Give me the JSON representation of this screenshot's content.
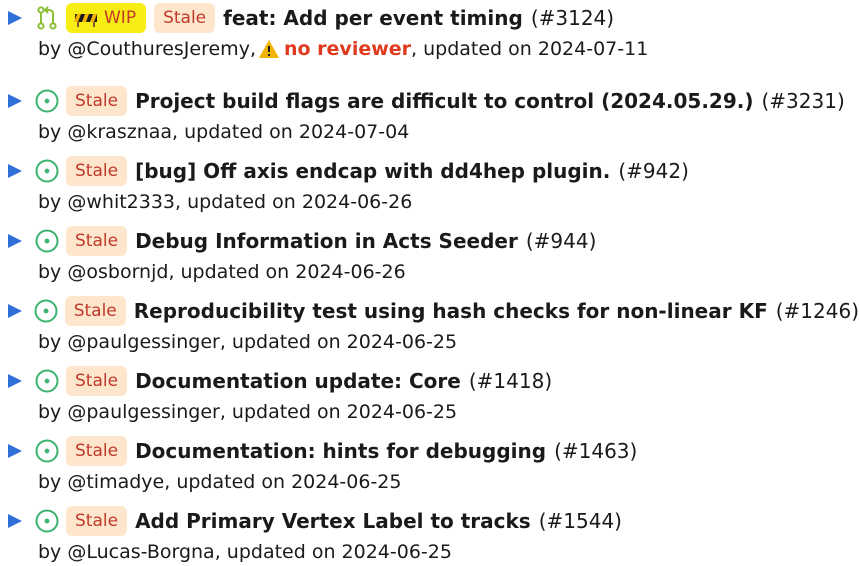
{
  "colors": {
    "accent_arrow": "#2f6fd8",
    "open_icon": "#3cb371",
    "draft_icon": "#8bbf35",
    "stale_bg": "#fde6cc",
    "wip_bg": "#f7ec14",
    "no_reviewer": "#e03a1e",
    "warning": "#f0b400"
  },
  "items": [
    {
      "icon": "pull-request-icon",
      "wip_label": "WIP",
      "stale_label": "Stale",
      "title": "feat: Add per event timing",
      "number": "(#3124)",
      "by": "by ",
      "author": "@CouthuresJeremy",
      "sep": ",",
      "no_reviewer": "no reviewer",
      "updated": ", updated on 2024-07-11"
    },
    {
      "icon": "issue-open-icon",
      "stale_label": "Stale",
      "title": "Project build flags are difficult to control (2024.05.29.)",
      "number": "(#3231)",
      "by": "by ",
      "author": "@krasznaa",
      "updated": ", updated on 2024-07-04"
    },
    {
      "icon": "issue-open-icon",
      "stale_label": "Stale",
      "title": "[bug] Off axis endcap with dd4hep plugin.",
      "number": "(#942)",
      "by": "by ",
      "author": "@whit2333",
      "updated": ", updated on 2024-06-26"
    },
    {
      "icon": "issue-open-icon",
      "stale_label": "Stale",
      "title": "Debug Information in Acts Seeder",
      "number": "(#944)",
      "by": "by ",
      "author": "@osbornjd",
      "updated": ", updated on 2024-06-26"
    },
    {
      "icon": "issue-open-icon",
      "stale_label": "Stale",
      "title": "Reproducibility test using hash checks for non-linear KF",
      "number": "(#1246)",
      "by": "by ",
      "author": "@paulgessinger",
      "updated": ", updated on 2024-06-25"
    },
    {
      "icon": "issue-open-icon",
      "stale_label": "Stale",
      "title": "Documentation update: Core",
      "number": "(#1418)",
      "by": "by ",
      "author": "@paulgessinger",
      "updated": ", updated on 2024-06-25"
    },
    {
      "icon": "issue-open-icon",
      "stale_label": "Stale",
      "title": "Documentation: hints for debugging",
      "number": "(#1463)",
      "by": "by ",
      "author": "@timadye",
      "updated": ", updated on 2024-06-25"
    },
    {
      "icon": "issue-open-icon",
      "stale_label": "Stale",
      "title": "Add Primary Vertex Label to tracks",
      "number": "(#1544)",
      "by": "by ",
      "author": "@Lucas-Borgna",
      "updated": ", updated on 2024-06-25"
    }
  ]
}
